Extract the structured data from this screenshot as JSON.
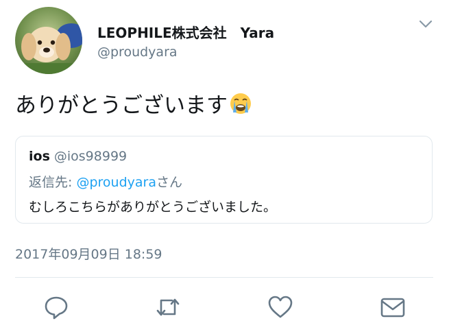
{
  "author": {
    "display_name": "LEOPHILE株式会社　Yara",
    "handle": "@proudyara",
    "avatar_icon": "dog-avatar"
  },
  "tweet": {
    "text": "ありがとうございます",
    "emoji_icon": "loudly-crying-face-emoji"
  },
  "quoted": {
    "name": "ios",
    "handle": "@ios98999",
    "reply_prefix": "返信先: ",
    "reply_user": "@proudyara",
    "reply_suffix": "さん",
    "text": "むしろこちらがありがとうございました。"
  },
  "timestamp": "2017年09月09日 18:59",
  "actions": [
    {
      "icon": "reply-icon"
    },
    {
      "icon": "retweet-icon"
    },
    {
      "icon": "like-heart-icon"
    },
    {
      "icon": "direct-message-icon"
    }
  ],
  "colors": {
    "text": "#14171a",
    "muted": "#657786",
    "link": "#1da1f2",
    "border": "#e1e8ed"
  }
}
